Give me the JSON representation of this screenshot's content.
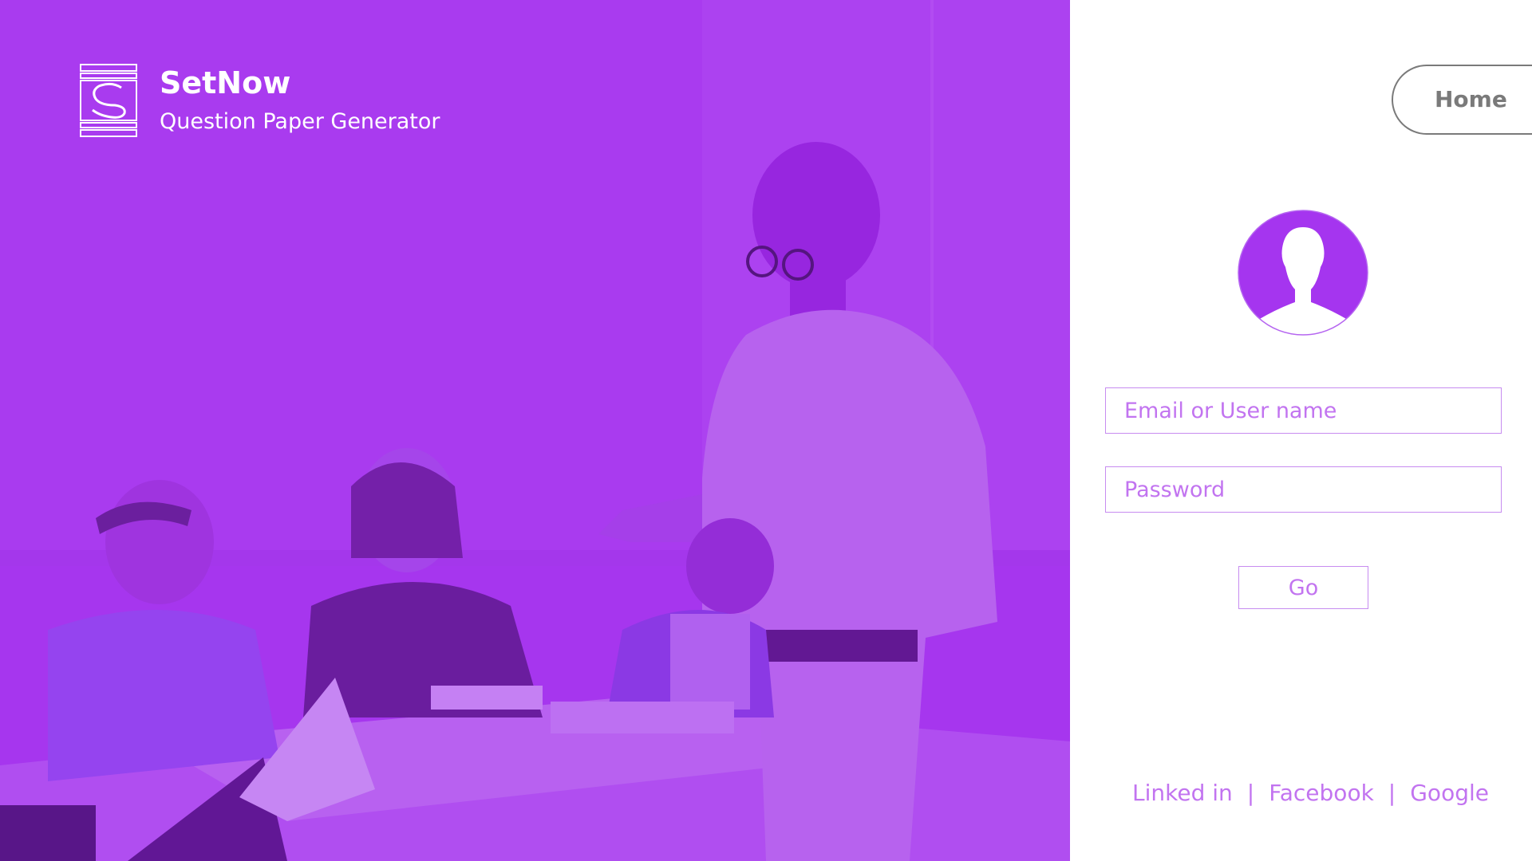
{
  "brand": {
    "name": "SetNow",
    "subtitle": "Question Paper Generator",
    "logo_icon": "setnow-logo-icon"
  },
  "colors": {
    "accent": "#a535ef",
    "field_border": "#c78cf0",
    "field_text": "#c274f0",
    "home_border": "#7a7a7a"
  },
  "nav": {
    "home_label": "Home"
  },
  "login": {
    "avatar_icon": "user-avatar-icon",
    "email_placeholder": "Email or User name",
    "password_placeholder": "Password",
    "go_label": "Go"
  },
  "social": {
    "links": [
      "Linked in",
      "Facebook",
      "Google"
    ],
    "separator": "|"
  }
}
